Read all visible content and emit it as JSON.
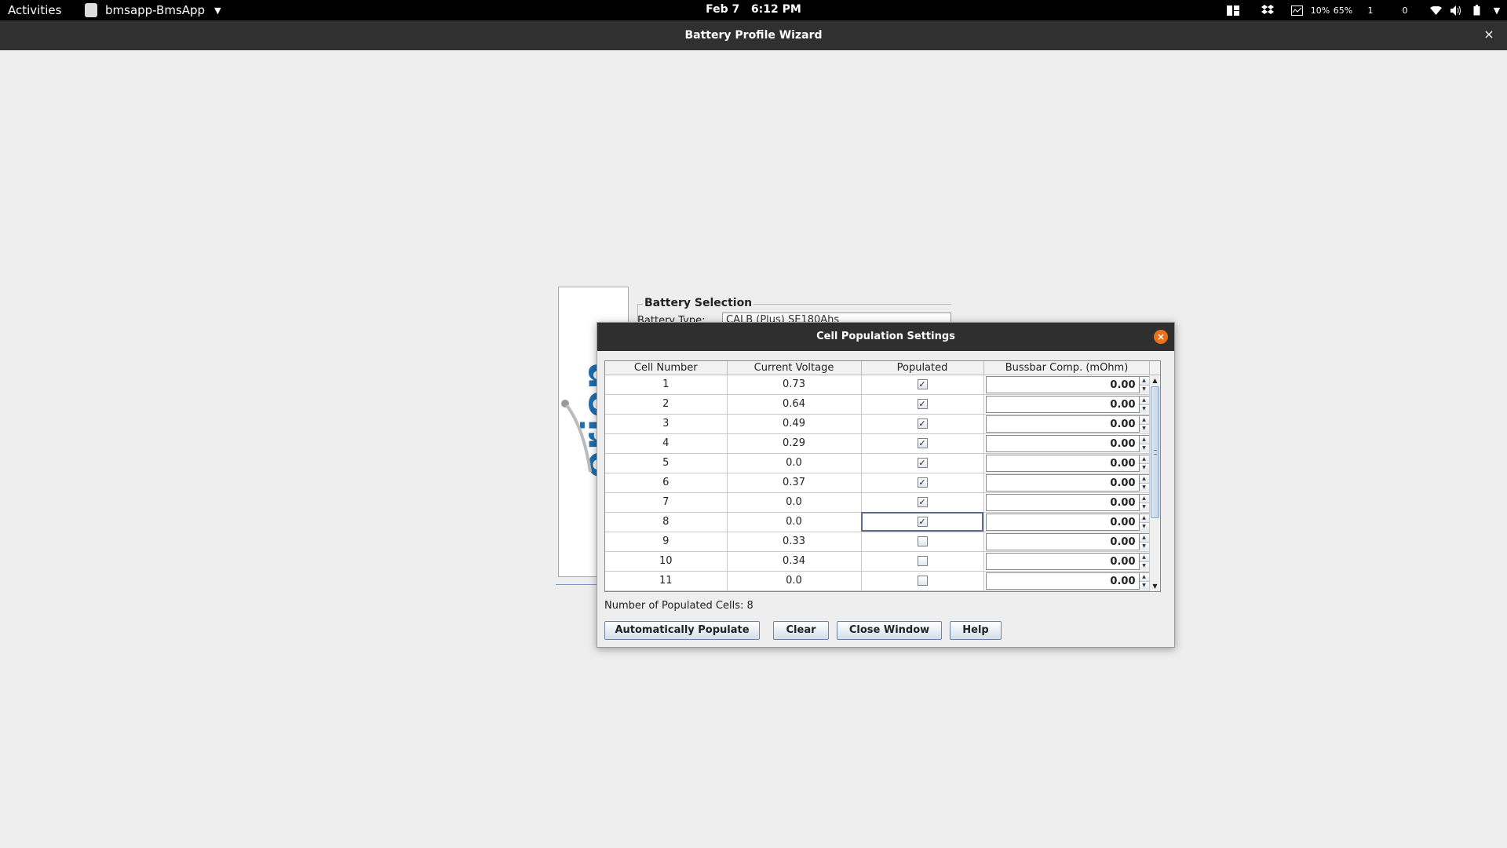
{
  "topbar": {
    "activities": "Activities",
    "app_name": "bmsapp-BmsApp",
    "clock": "Feb 7   6:12 PM",
    "tray": {
      "cpu": "10%",
      "mem": "65%",
      "net_up": "1",
      "net_down": "0"
    }
  },
  "window": {
    "title": "Battery Profile Wizard",
    "close_glyph": "×"
  },
  "wizard": {
    "logo_text": "orion",
    "battery_selection_label": "Battery Selection",
    "battery_type_label": "Battery Type:",
    "battery_type_value": "CALB (Plus) SE180Ahs"
  },
  "dialog": {
    "title": "Cell Population Settings",
    "close_glyph": "×",
    "columns": [
      "Cell Number",
      "Current Voltage",
      "Populated",
      "Bussbar Comp. (mOhm)"
    ],
    "rows": [
      {
        "cell": "1",
        "voltage": "0.73",
        "populated": true,
        "bussbar": "0.00"
      },
      {
        "cell": "2",
        "voltage": "0.64",
        "populated": true,
        "bussbar": "0.00"
      },
      {
        "cell": "3",
        "voltage": "0.49",
        "populated": true,
        "bussbar": "0.00"
      },
      {
        "cell": "4",
        "voltage": "0.29",
        "populated": true,
        "bussbar": "0.00"
      },
      {
        "cell": "5",
        "voltage": "0.0",
        "populated": true,
        "bussbar": "0.00"
      },
      {
        "cell": "6",
        "voltage": "0.37",
        "populated": true,
        "bussbar": "0.00"
      },
      {
        "cell": "7",
        "voltage": "0.0",
        "populated": true,
        "bussbar": "0.00"
      },
      {
        "cell": "8",
        "voltage": "0.0",
        "populated": true,
        "bussbar": "0.00"
      },
      {
        "cell": "9",
        "voltage": "0.33",
        "populated": false,
        "bussbar": "0.00"
      },
      {
        "cell": "10",
        "voltage": "0.34",
        "populated": false,
        "bussbar": "0.00"
      },
      {
        "cell": "11",
        "voltage": "0.0",
        "populated": false,
        "bussbar": "0.00"
      }
    ],
    "populated_count_label": "Number of Populated Cells:",
    "populated_count": "8",
    "buttons": {
      "auto": "Automatically Populate",
      "clear": "Clear",
      "close": "Close Window",
      "help": "Help"
    }
  }
}
